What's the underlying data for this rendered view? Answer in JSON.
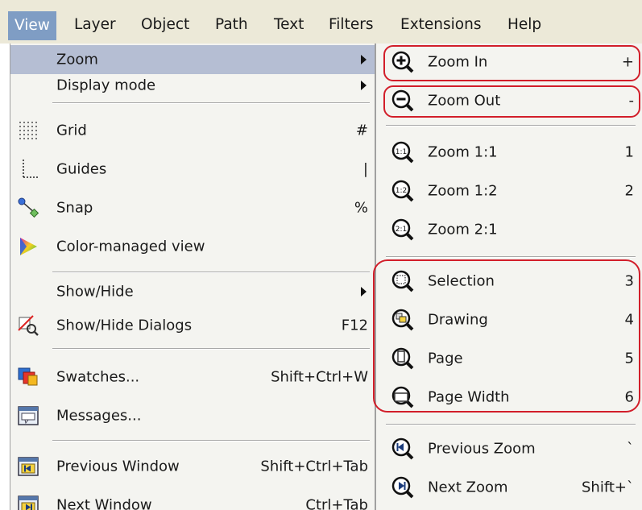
{
  "menubar": {
    "items": [
      "View",
      "Layer",
      "Object",
      "Path",
      "Text",
      "Filters",
      "Extensions",
      "Help"
    ]
  },
  "left_menu": {
    "zoom": "Zoom",
    "display_mode": "Display mode",
    "grid": "Grid",
    "grid_shortcut": "#",
    "guides": "Guides",
    "guides_shortcut": "|",
    "snap": "Snap",
    "snap_shortcut": "%",
    "color_managed": "Color-managed view",
    "show_hide": "Show/Hide",
    "show_hide_dialogs": "Show/Hide Dialogs",
    "show_hide_dialogs_shortcut": "F12",
    "swatches": "Swatches...",
    "swatches_shortcut": "Shift+Ctrl+W",
    "messages": "Messages...",
    "previous_window": "Previous Window",
    "previous_window_shortcut": "Shift+Ctrl+Tab",
    "next_window": "Next Window",
    "next_window_shortcut": "Ctrl+Tab"
  },
  "zoom_menu": {
    "zoom_in": "Zoom In",
    "zoom_in_shortcut": "+",
    "zoom_out": "Zoom Out",
    "zoom_out_shortcut": "-",
    "zoom_1_1": "Zoom 1:1",
    "zoom_1_1_shortcut": "1",
    "zoom_1_2": "Zoom 1:2",
    "zoom_1_2_shortcut": "2",
    "zoom_2_1": "Zoom 2:1",
    "selection": "Selection",
    "selection_shortcut": "3",
    "drawing": "Drawing",
    "drawing_shortcut": "4",
    "page": "Page",
    "page_shortcut": "5",
    "page_width": "Page Width",
    "page_width_shortcut": "6",
    "previous_zoom": "Previous Zoom",
    "previous_zoom_shortcut": "`",
    "next_zoom": "Next Zoom",
    "next_zoom_shortcut": "Shift+`"
  },
  "colors": {
    "menubar_bg": "#ece9d8",
    "active_menu": "#7f9dc4",
    "highlight_row": "#b5bed3",
    "menu_bg": "#f4f4f0",
    "annotation_red": "#d21e2a"
  }
}
